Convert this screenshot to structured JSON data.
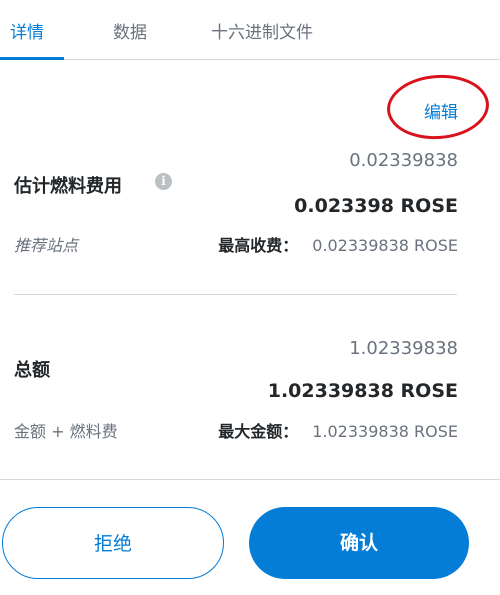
{
  "tabs": [
    {
      "label": "详情",
      "active": true
    },
    {
      "label": "数据",
      "active": false
    },
    {
      "label": "十六进制文件",
      "active": false
    }
  ],
  "edit": {
    "label": "编辑"
  },
  "gas": {
    "label": "估计燃料费用",
    "info_icon": "i",
    "secondary_value": "0.02339838",
    "primary_value": "0.023398 ROSE",
    "suggestion_label": "推荐站点",
    "max_fee_label": "最高收费：",
    "max_fee_value": "0.02339838 ROSE"
  },
  "total": {
    "label": "总额",
    "secondary_value": "1.02339838",
    "primary_value": "1.02339838 ROSE",
    "breakdown_label": "金额 + 燃料费",
    "max_amount_label": "最大金额：",
    "max_amount_value": "1.02339838 ROSE"
  },
  "footer": {
    "reject_label": "拒绝",
    "confirm_label": "确认"
  },
  "colors": {
    "accent": "#037dd6",
    "annotation": "#d9121b",
    "muted": "#6a737d",
    "text": "#24272a"
  }
}
